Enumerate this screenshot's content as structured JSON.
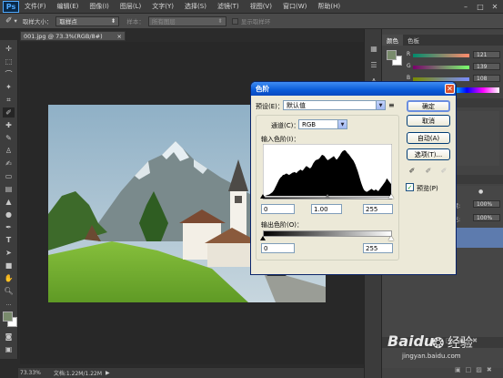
{
  "menubar": {
    "logo": "Ps",
    "items": [
      "文件(F)",
      "编辑(E)",
      "图像(I)",
      "图层(L)",
      "文字(Y)",
      "选择(S)",
      "滤镜(T)",
      "视图(V)",
      "窗口(W)",
      "帮助(H)"
    ],
    "controls": [
      "–",
      "□",
      "✕"
    ]
  },
  "optionsbar": {
    "sample_size_label": "取样大小：",
    "sample_size_value": "取样点",
    "sample_label": "样本：",
    "sample_value": "所有图层",
    "show_ring_label": "显示取样环"
  },
  "document": {
    "tab_title": "001.jpg @ 73.3%(RGB/8#)",
    "tab_close": "×"
  },
  "statusbar": {
    "zoom": "73.33%",
    "doc_info": "文档:1.22M/1.22M",
    "arrow": "▶"
  },
  "panel": {
    "color_tabs": [
      "颜色",
      "色板"
    ],
    "sliders": [
      {
        "letter": "R",
        "value": "121"
      },
      {
        "letter": "G",
        "value": "139"
      },
      {
        "letter": "B",
        "value": "108"
      }
    ],
    "opacity_label": "明度:",
    "opacity_value": "100%",
    "fill_label": "填充:",
    "fill_value": "100%",
    "colors": {
      "fg": "#798b6c",
      "bg": "#ffffff"
    }
  },
  "levels": {
    "title": "色阶",
    "close": "✕",
    "preset_label": "预设(E)：",
    "preset_value": "默认值",
    "channel_label": "通道(C)：",
    "channel_value": "RGB",
    "input_label": "输入色阶(I)：",
    "input_values": [
      "0",
      "1.00",
      "255"
    ],
    "output_label": "输出色阶(O)：",
    "output_values": [
      "0",
      "255"
    ],
    "buttons": {
      "ok": "确定",
      "cancel": "取消",
      "auto": "自动(A)",
      "options": "选项(T)..."
    },
    "preview_label": "预览(P)",
    "preview_checked": true,
    "histogram": [
      0,
      0,
      0,
      1,
      1,
      2,
      2,
      3,
      4,
      5,
      6,
      8,
      10,
      13,
      16,
      19,
      22,
      25,
      28,
      30,
      32,
      33,
      35,
      36,
      36,
      37,
      38,
      38,
      37,
      36,
      36,
      37,
      38,
      39,
      40,
      40,
      41,
      40,
      39,
      40,
      42,
      43,
      44,
      45,
      44,
      43,
      44,
      46,
      48,
      50,
      51,
      50,
      49,
      48,
      47,
      48,
      50,
      53,
      56,
      58,
      60,
      61,
      62,
      62,
      63,
      64,
      66,
      68,
      70,
      70,
      69,
      68,
      66,
      64,
      62,
      61,
      62,
      63,
      64,
      65,
      66,
      67,
      68,
      66,
      64,
      62,
      63,
      65,
      67,
      69,
      72,
      74,
      76,
      77,
      78,
      78,
      77,
      75,
      73,
      72,
      70,
      68,
      66,
      64,
      62,
      60,
      57,
      54,
      50,
      46,
      42,
      37,
      32,
      27,
      22,
      18,
      14,
      11,
      9,
      8,
      7,
      7,
      8,
      9,
      10,
      11,
      12,
      11,
      10,
      9,
      10,
      11,
      10,
      9,
      8,
      10,
      12,
      14,
      16,
      18,
      20,
      22,
      24,
      27,
      30,
      28,
      26,
      24,
      22,
      20
    ]
  },
  "watermark": {
    "brand": "Baidu",
    "brand_cn": "经验",
    "url": "jingyan.baidu.com"
  }
}
